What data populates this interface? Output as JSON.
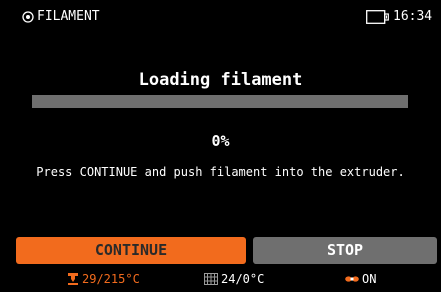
{
  "header": {
    "title": "FILAMENT",
    "time": "16:34",
    "icons": [
      "screen-icon",
      "usb-storage-icon"
    ]
  },
  "main": {
    "heading": "Loading filament",
    "progress": 0,
    "percent_text": "0%",
    "instruction": "Press CONTINUE and push filament into the extruder."
  },
  "buttons": {
    "continue_label": "CONTINUE",
    "stop_label": "STOP"
  },
  "status": {
    "nozzle_temp": "29/215°C",
    "bed_temp": "24/0°C",
    "fan_state": "ON",
    "icons": [
      "nozzle-icon",
      "bed-icon",
      "fan-icon"
    ]
  },
  "colors": {
    "accent": "#f26b1d",
    "button_inactive": "#6f6f6f",
    "progress_track": "#6f6f6f",
    "background": "#000000",
    "fan_icon": "#f26b1d"
  }
}
